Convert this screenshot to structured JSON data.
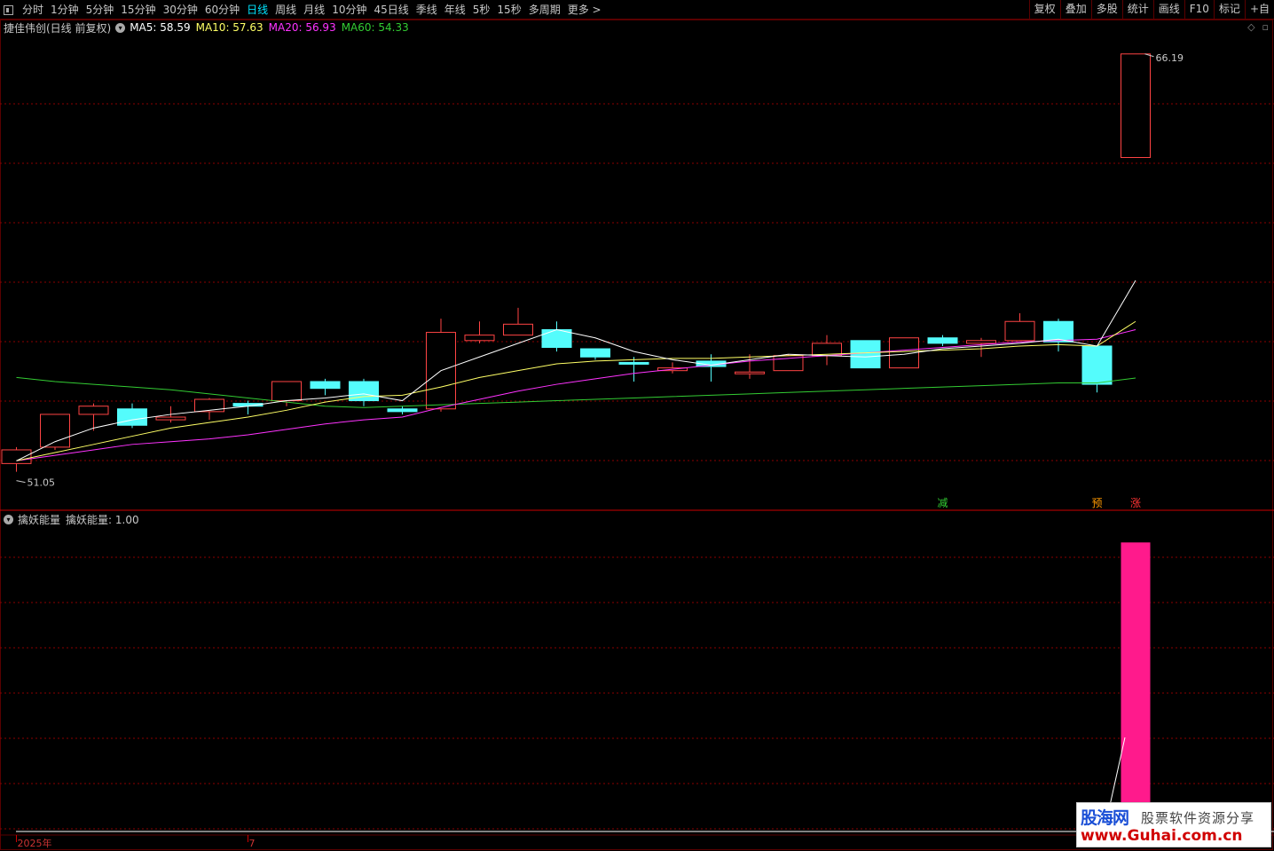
{
  "toolbar": {
    "periods": [
      {
        "label": "分时",
        "active": false
      },
      {
        "label": "1分钟",
        "active": false
      },
      {
        "label": "5分钟",
        "active": false
      },
      {
        "label": "15分钟",
        "active": false
      },
      {
        "label": "30分钟",
        "active": false
      },
      {
        "label": "60分钟",
        "active": false
      },
      {
        "label": "日线",
        "active": true
      },
      {
        "label": "周线",
        "active": false
      },
      {
        "label": "月线",
        "active": false
      },
      {
        "label": "10分钟",
        "active": false
      },
      {
        "label": "45日线",
        "active": false
      },
      {
        "label": "季线",
        "active": false
      },
      {
        "label": "年线",
        "active": false
      },
      {
        "label": "5秒",
        "active": false
      },
      {
        "label": "15秒",
        "active": false
      },
      {
        "label": "多周期",
        "active": false
      },
      {
        "label": "更多 >",
        "active": false
      }
    ],
    "right_buttons": [
      "复权",
      "叠加",
      "多股",
      "统计",
      "画线",
      "F10",
      "标记",
      "+自"
    ]
  },
  "main": {
    "stock_name": "捷佳伟创(日线 前复权)",
    "ma": [
      {
        "label": "MA5: 58.59",
        "color": "#ffffff"
      },
      {
        "label": "MA10: 57.63",
        "color": "#ffff66"
      },
      {
        "label": "MA20: 56.93",
        "color": "#ff33ff"
      },
      {
        "label": "MA60: 54.33",
        "color": "#33cc33"
      }
    ],
    "high_label": "66.19",
    "low_label": "51.05",
    "signals": [
      {
        "text": "减",
        "index": 24,
        "color": "#33cc33"
      },
      {
        "text": "预",
        "index": 28,
        "color": "#ff9900"
      },
      {
        "text": "涨",
        "index": 29,
        "color": "#ff3333"
      }
    ]
  },
  "indicator": {
    "name": "擒妖能量",
    "value_label": "擒妖能量: 1.00"
  },
  "x_axis": {
    "labels": [
      {
        "text": "2025年",
        "index": 0
      },
      {
        "text": "7",
        "index": 6
      }
    ]
  },
  "colors": {
    "up": "#ff4444",
    "down": "#54fcfc",
    "grid": "#8b0000",
    "energy": "#ff1a8c"
  },
  "chart_data": {
    "type": "candlestick",
    "ylim": [
      50.4,
      66.8
    ],
    "candles": [
      {
        "o": 51.2,
        "c": 51.7,
        "h": 51.8,
        "l": 50.9
      },
      {
        "o": 51.8,
        "c": 53.0,
        "h": 53.0,
        "l": 51.7
      },
      {
        "o": 53.0,
        "c": 53.3,
        "h": 53.4,
        "l": 52.4
      },
      {
        "o": 53.2,
        "c": 52.6,
        "h": 53.4,
        "l": 52.5
      },
      {
        "o": 52.8,
        "c": 52.9,
        "h": 53.3,
        "l": 52.7
      },
      {
        "o": 53.1,
        "c": 53.55,
        "h": 53.6,
        "l": 52.8
      },
      {
        "o": 53.4,
        "c": 53.3,
        "h": 53.5,
        "l": 53.0
      },
      {
        "o": 53.5,
        "c": 54.2,
        "h": 54.2,
        "l": 53.3
      },
      {
        "o": 54.2,
        "c": 53.95,
        "h": 54.3,
        "l": 53.7
      },
      {
        "o": 54.2,
        "c": 53.5,
        "h": 54.3,
        "l": 53.3
      },
      {
        "o": 53.2,
        "c": 53.1,
        "h": 53.3,
        "l": 53.0
      },
      {
        "o": 53.2,
        "c": 56.0,
        "h": 56.5,
        "l": 53.1
      },
      {
        "o": 55.7,
        "c": 55.9,
        "h": 56.4,
        "l": 55.6
      },
      {
        "o": 55.9,
        "c": 56.3,
        "h": 56.9,
        "l": 55.9
      },
      {
        "o": 56.1,
        "c": 55.45,
        "h": 56.4,
        "l": 55.3
      },
      {
        "o": 55.4,
        "c": 55.1,
        "h": 55.4,
        "l": 55.0
      },
      {
        "o": 54.9,
        "c": 54.85,
        "h": 55.1,
        "l": 54.2
      },
      {
        "o": 54.6,
        "c": 54.7,
        "h": 54.9,
        "l": 54.5
      },
      {
        "o": 54.95,
        "c": 54.75,
        "h": 55.2,
        "l": 54.2
      },
      {
        "o": 54.5,
        "c": 54.55,
        "h": 55.2,
        "l": 54.3
      },
      {
        "o": 54.6,
        "c": 55.15,
        "h": 55.2,
        "l": 54.6
      },
      {
        "o": 55.15,
        "c": 55.6,
        "h": 55.9,
        "l": 54.8
      },
      {
        "o": 55.7,
        "c": 54.7,
        "h": 55.7,
        "l": 54.7
      },
      {
        "o": 54.7,
        "c": 55.8,
        "h": 55.8,
        "l": 54.7
      },
      {
        "o": 55.8,
        "c": 55.6,
        "h": 55.9,
        "l": 55.5
      },
      {
        "o": 55.6,
        "c": 55.7,
        "h": 55.8,
        "l": 55.1
      },
      {
        "o": 55.7,
        "c": 56.4,
        "h": 56.7,
        "l": 55.7
      },
      {
        "o": 56.4,
        "c": 55.65,
        "h": 56.5,
        "l": 55.3
      },
      {
        "o": 55.5,
        "c": 54.1,
        "h": 55.5,
        "l": 53.8
      },
      {
        "o": 62.4,
        "c": 66.19,
        "h": 66.19,
        "l": 62.4
      }
    ],
    "ma5": [
      51.3,
      52.0,
      52.5,
      52.8,
      53.0,
      53.15,
      53.3,
      53.5,
      53.6,
      53.75,
      53.5,
      54.6,
      55.1,
      55.6,
      56.1,
      55.8,
      55.3,
      55.0,
      54.8,
      55.0,
      55.2,
      55.15,
      55.1,
      55.2,
      55.4,
      55.5,
      55.6,
      55.75,
      55.5,
      57.9
    ],
    "ma10": [
      51.3,
      51.6,
      51.9,
      52.2,
      52.5,
      52.7,
      52.9,
      53.15,
      53.45,
      53.65,
      53.7,
      54.0,
      54.35,
      54.6,
      54.85,
      54.95,
      55.0,
      55.05,
      55.05,
      55.1,
      55.15,
      55.2,
      55.25,
      55.3,
      55.35,
      55.4,
      55.5,
      55.55,
      55.5,
      56.4
    ],
    "ma20": [
      51.3,
      51.5,
      51.7,
      51.9,
      52.0,
      52.1,
      52.25,
      52.45,
      52.65,
      52.8,
      52.9,
      53.25,
      53.55,
      53.85,
      54.1,
      54.3,
      54.5,
      54.65,
      54.8,
      54.95,
      55.05,
      55.15,
      55.25,
      55.35,
      55.45,
      55.55,
      55.65,
      55.7,
      55.75,
      56.1
    ],
    "ma60": [
      54.35,
      54.2,
      54.1,
      54.0,
      53.9,
      53.75,
      53.6,
      53.45,
      53.3,
      53.25,
      53.3,
      53.35,
      53.4,
      53.45,
      53.5,
      53.55,
      53.6,
      53.65,
      53.7,
      53.75,
      53.8,
      53.85,
      53.9,
      53.95,
      54.0,
      54.05,
      54.1,
      54.15,
      54.15,
      54.33
    ],
    "energy": [
      0,
      0,
      0,
      0,
      0,
      0,
      0,
      0,
      0,
      0,
      0,
      0,
      0,
      0,
      0,
      0,
      0,
      0,
      0,
      0,
      0,
      0,
      0,
      0,
      0,
      0,
      0,
      0,
      0,
      1.0
    ],
    "energy_ylim": [
      0,
      1.05
    ]
  }
}
